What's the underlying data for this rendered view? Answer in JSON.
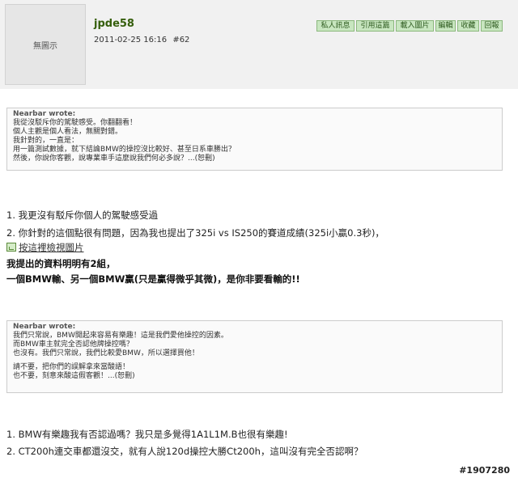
{
  "post": {
    "avatar_text": "無圖示",
    "username": "jpde58",
    "datetime": "2011-02-25 16:16",
    "post_number": "#62"
  },
  "toolbar": {
    "buttons": [
      "私人訊息",
      "引用這篇",
      "載入圖片",
      "編輯",
      "收藏",
      "回報"
    ]
  },
  "quote1": {
    "title": "Nearbar wrote:",
    "lines": [
      "我從沒駁斥你的駕駛感受。你翻翻看！",
      "個人主觀是個人看法，無關對錯。",
      "我針對的，一直是：",
      "用一篇測試數據，就下結論BMW的操控沒比較好、甚至日系車勝出？",
      "然後，你說你客觀，說專業車手這麼說我們何必多說？...(恕刪)"
    ]
  },
  "reply1": {
    "line1": "1. 我更沒有駁斥你個人的駕駛感受過",
    "line2": "2. 你針對的這個點很有問題，因為我也提出了325i vs IS250的賽道成績(325i小贏0.3秒)，",
    "image_link": "按這裡檢視圖片",
    "bold1": "我提出的資料明明有2組，",
    "bold2": "一個BMW輸、另一個BMW贏(只是贏得微乎其微)，是你非要看輸的!!"
  },
  "quote2": {
    "title": "Nearbar wrote:",
    "lines_a": [
      "我們只常說，BMW開起來容易有樂趣！這是我們愛他操控的因素。",
      "而BMW車主就完全否認他牌操控嗎？",
      "也沒有。我們只常說，我們比較愛BMW，所以選擇買他！"
    ],
    "lines_b": [
      "請不要，把你們的誤解拿來當酸語！",
      "也不要，刻意來酸這假客觀！...(恕刪)"
    ]
  },
  "reply2": {
    "line1": "1. BMW有樂趣我有否認過嗎？我只是多覺得1A1L1M.B也很有樂趣!",
    "line2": "2. CT200h連交車都還沒交，就有人說120d操控大勝Ct200h，這叫沒有完全否認啊？"
  },
  "footer": {
    "id": "#1907280"
  }
}
